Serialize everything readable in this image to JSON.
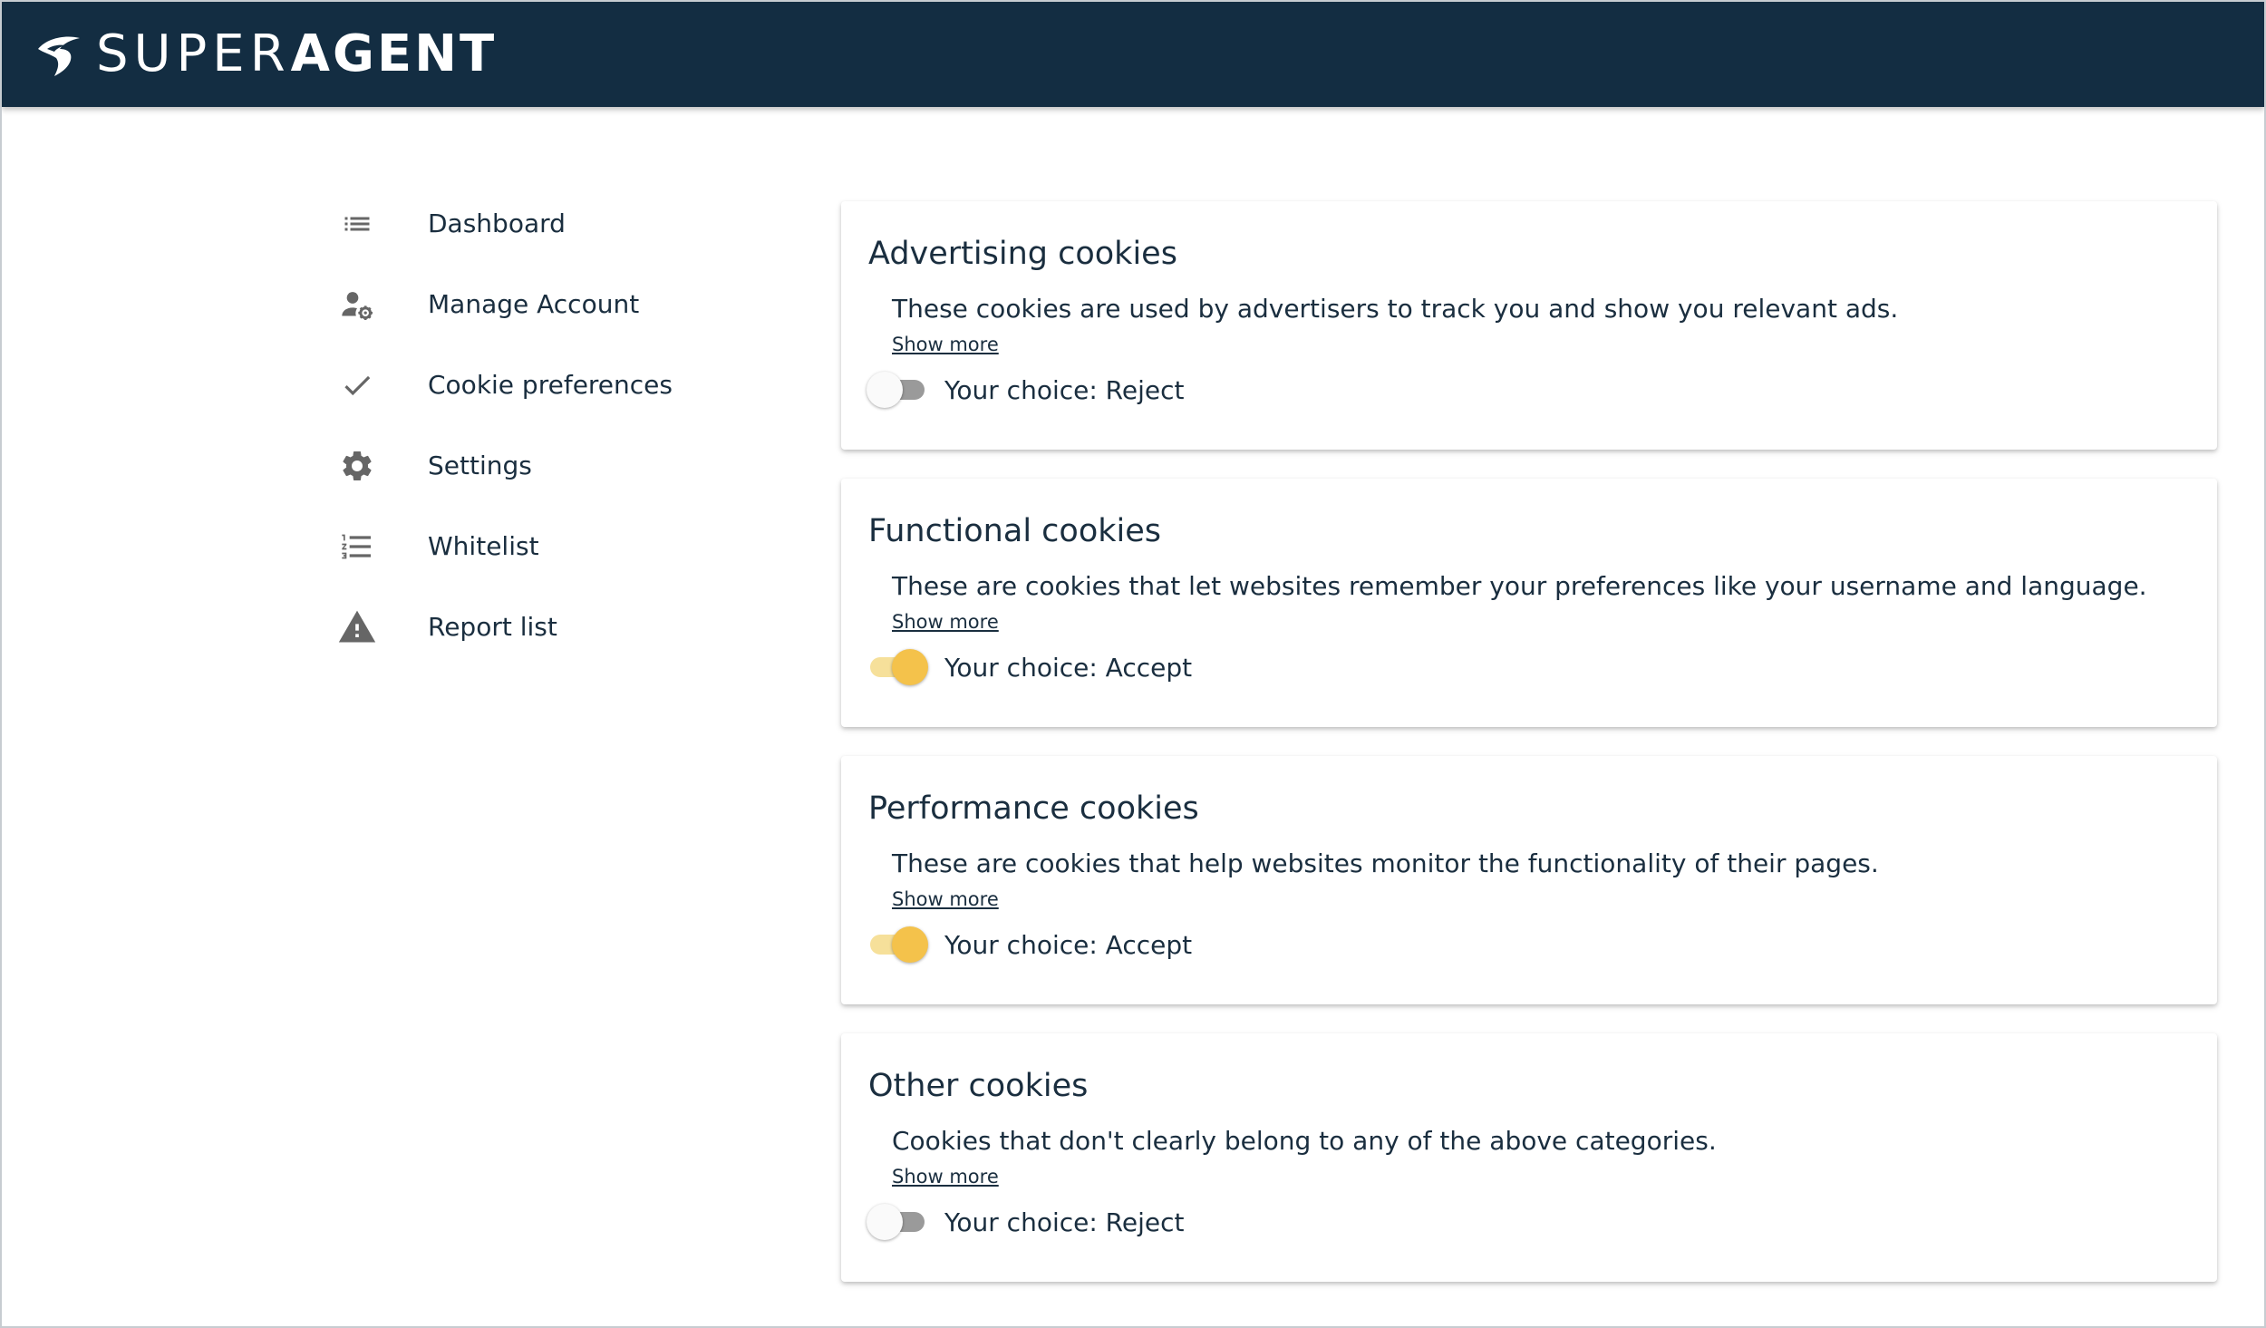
{
  "app": {
    "logo_light": "SUPER",
    "logo_bold": "AGENT",
    "logo_icon": "superagent-logo-icon",
    "header_color": "#132d42"
  },
  "sidebar": {
    "items": [
      {
        "label": "Dashboard",
        "icon": "list-icon"
      },
      {
        "label": "Manage Account",
        "icon": "user-gear-icon"
      },
      {
        "label": "Cookie preferences",
        "icon": "check-icon"
      },
      {
        "label": "Settings",
        "icon": "gear-icon"
      },
      {
        "label": "Whitelist",
        "icon": "numbered-list-icon"
      },
      {
        "label": "Report list",
        "icon": "warning-icon"
      }
    ]
  },
  "cards": [
    {
      "title": "Advertising cookies",
      "description": "These cookies are used by advertisers to track you and show you relevant ads.",
      "show_more": "Show more",
      "choice_label": "Your choice: Reject",
      "enabled": false
    },
    {
      "title": "Functional cookies",
      "description": "These are cookies that let websites remember your preferences like your username and language.",
      "show_more": "Show more",
      "choice_label": "Your choice: Accept",
      "enabled": true
    },
    {
      "title": "Performance cookies",
      "description": "These are cookies that help websites monitor the functionality of their pages.",
      "show_more": "Show more",
      "choice_label": "Your choice: Accept",
      "enabled": true
    },
    {
      "title": "Other cookies",
      "description": "Cookies that don't clearly belong to any of the above categories.",
      "show_more": "Show more",
      "choice_label": "Your choice: Reject",
      "enabled": false
    }
  ],
  "colors": {
    "accent": "#f4c24b",
    "accent_track": "#f6e09a",
    "text": "#1a2e3f",
    "icon": "#666666"
  }
}
